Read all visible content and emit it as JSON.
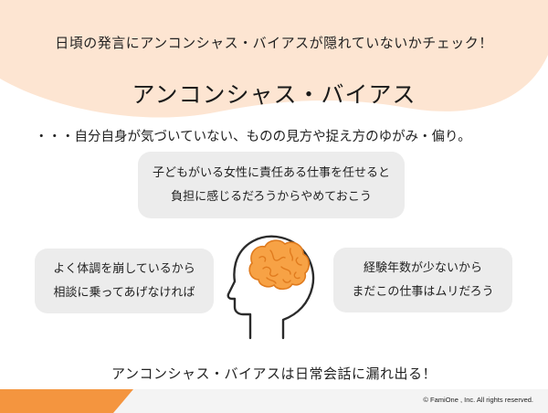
{
  "header": {
    "text": "日頃の発言にアンコンシャス・バイアスが隠れていないかチェック！"
  },
  "title": "アンコンシャス・バイアス",
  "definition": "・・・自分自身が気づいていない、ものの見方や捉え方のゆがみ・偏り。",
  "examples": {
    "top": {
      "line1": "子どもがいる女性に責任ある仕事を任せると",
      "line2": "負担に感じるだろうからやめておこう"
    },
    "left": {
      "line1": "よく体調を崩しているから",
      "line2": "相談に乗ってあげなければ"
    },
    "right": {
      "line1": "経験年数が少ないから",
      "line2": "まだこの仕事はムリだろう"
    }
  },
  "illustration": {
    "icon": "head-with-brain-icon"
  },
  "conclusion": "アンコンシャス・バイアスは日常会話に漏れ出る！",
  "footer": {
    "copyright": "© FamiOne , Inc. All rights reserved."
  },
  "colors": {
    "accent_peach": "#fde5d2",
    "accent_orange": "#f4953f",
    "bubble_gray": "#ececec"
  }
}
